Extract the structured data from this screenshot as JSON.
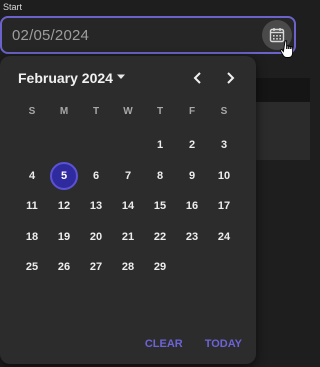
{
  "field": {
    "label": "Start",
    "value": "02/05/2024"
  },
  "calendar": {
    "month_label": "February 2024",
    "weekdays": [
      "S",
      "M",
      "T",
      "W",
      "T",
      "F",
      "S"
    ],
    "leading_blanks": 4,
    "days": [
      1,
      2,
      3,
      4,
      5,
      6,
      7,
      8,
      9,
      10,
      11,
      12,
      13,
      14,
      15,
      16,
      17,
      18,
      19,
      20,
      21,
      22,
      23,
      24,
      25,
      26,
      27,
      28,
      29
    ],
    "selected_day": 5
  },
  "actions": {
    "clear": "CLEAR",
    "today": "TODAY"
  },
  "colors": {
    "accent": "#6b63c9",
    "selected_fill": "#2f2a9d",
    "action_text": "#6d63d7"
  },
  "icons": {
    "calendar": "calendar-icon",
    "dropdown": "caret-down-icon",
    "prev": "chevron-left-icon",
    "next": "chevron-right-icon",
    "cursor": "hand-pointer-icon"
  }
}
